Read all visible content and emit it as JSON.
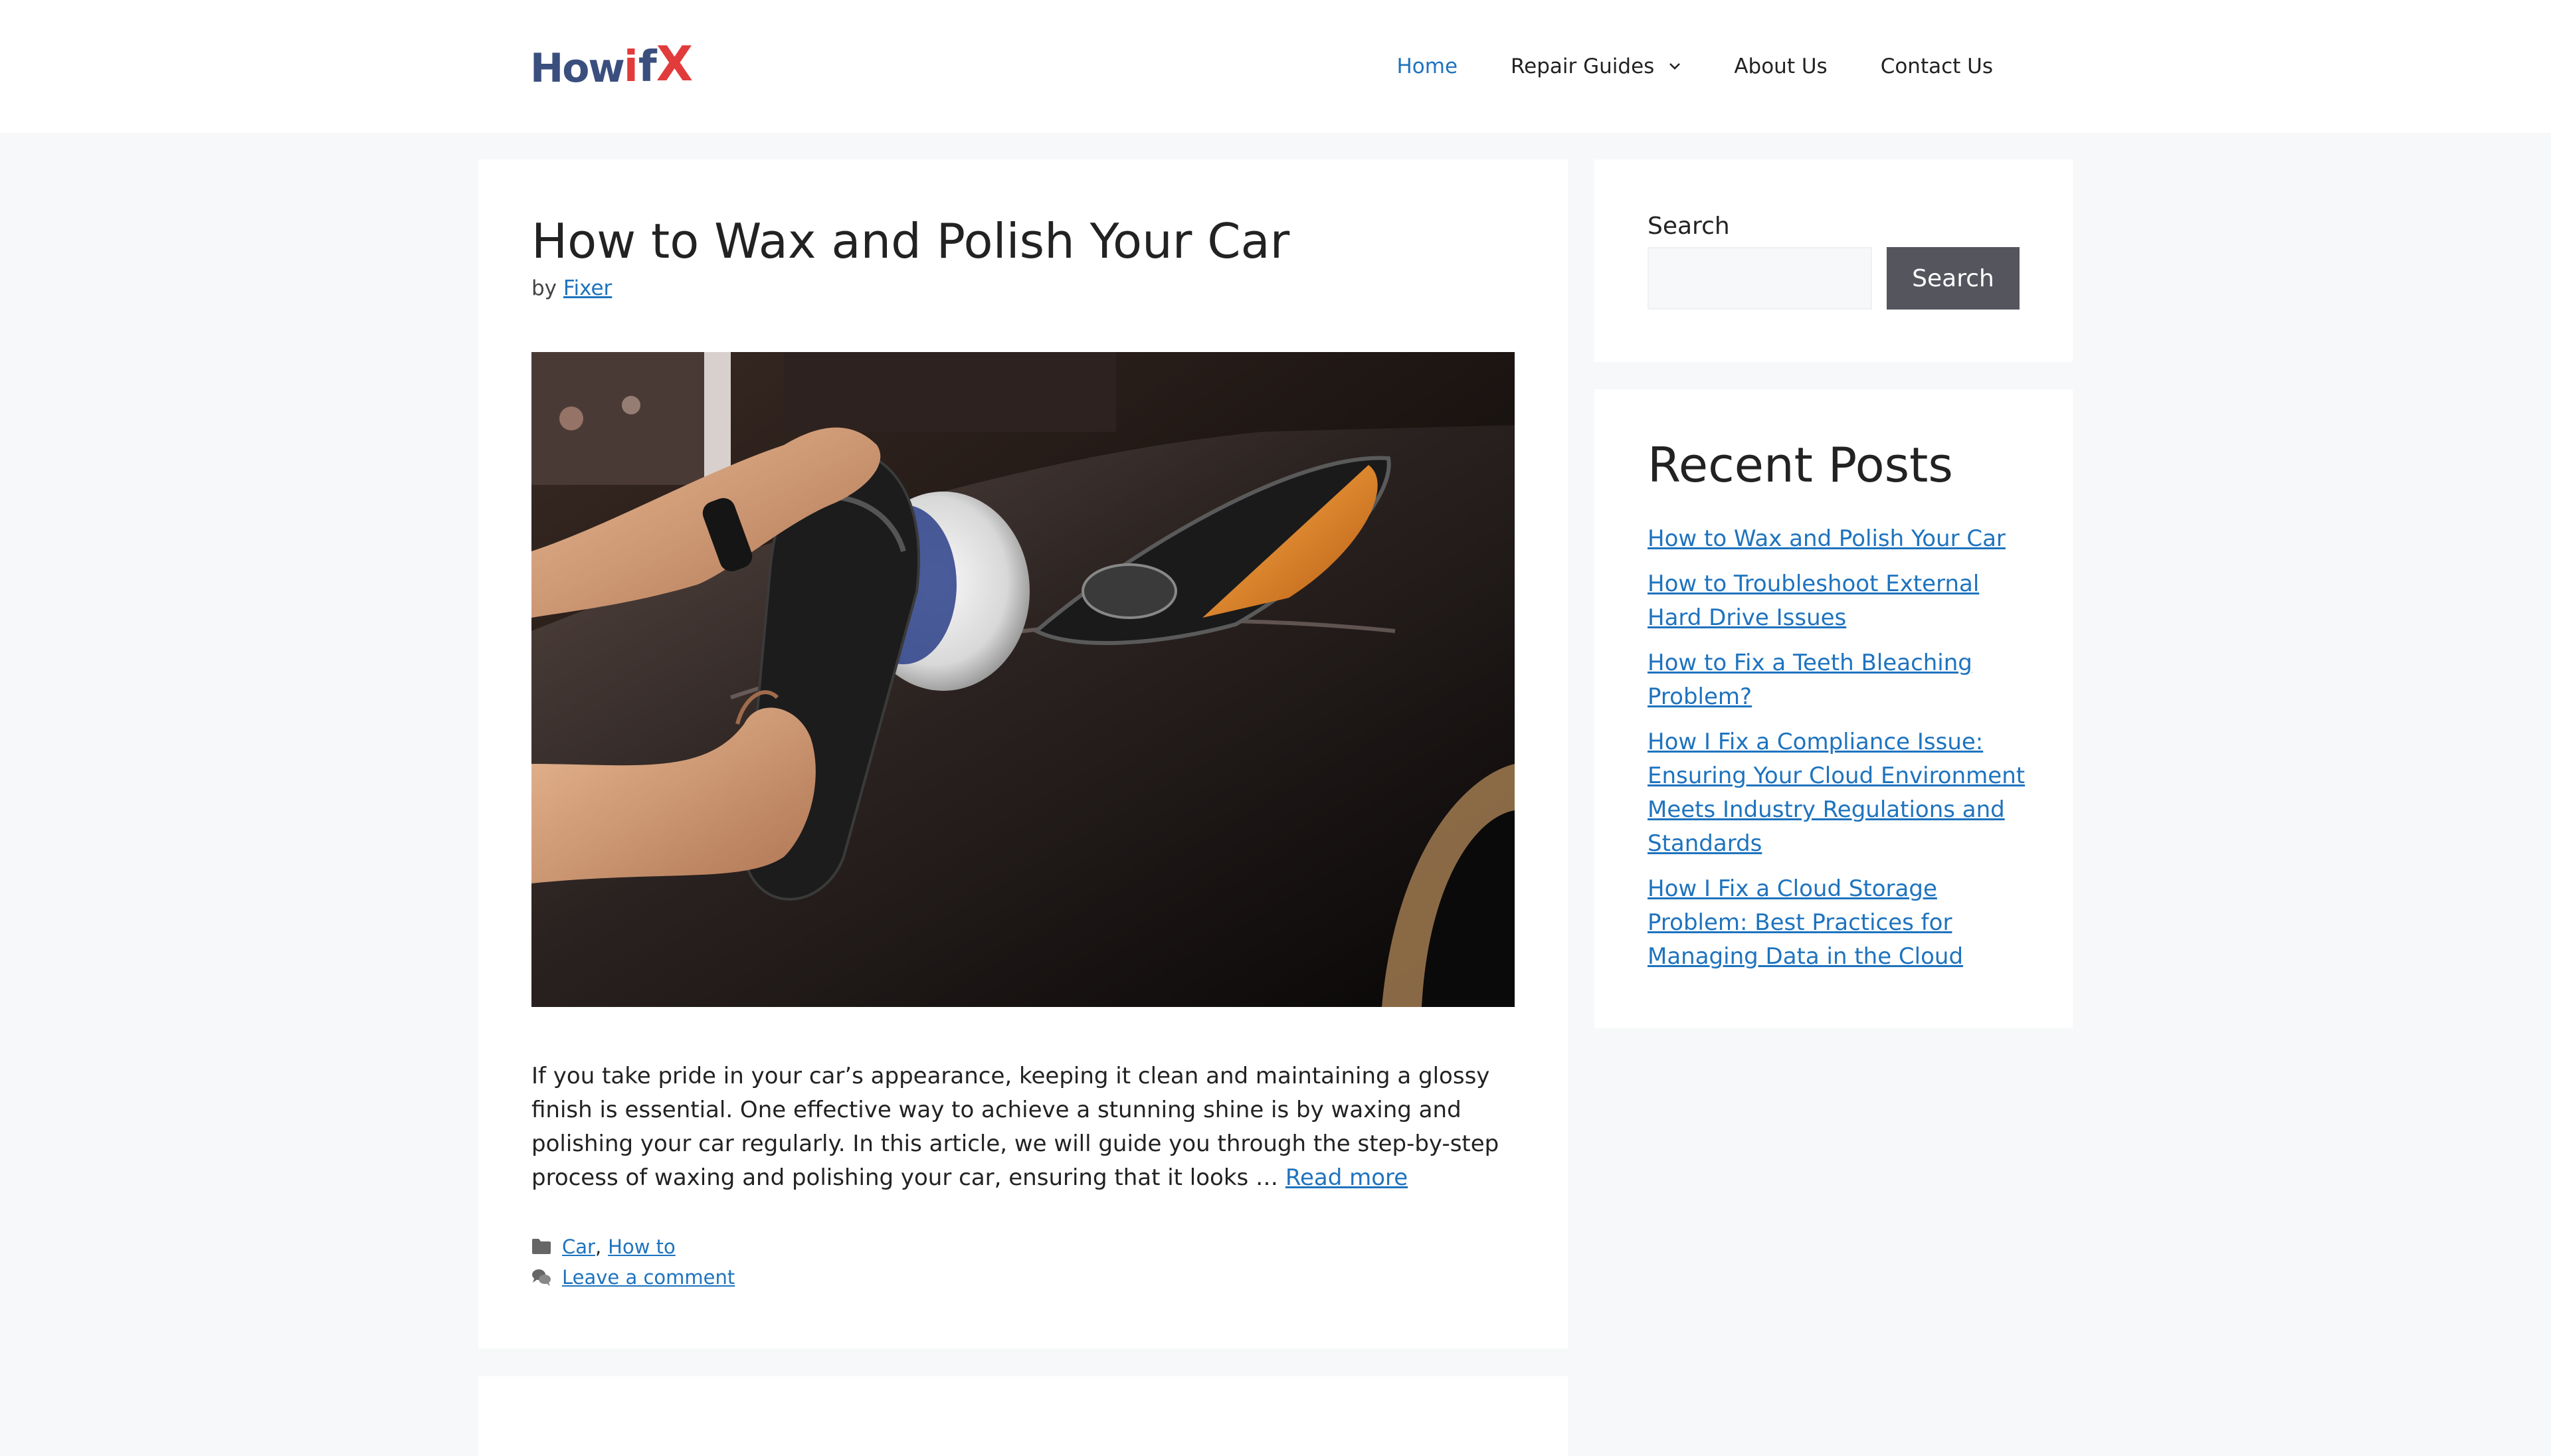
{
  "header": {
    "logo": {
      "how": "How",
      "i": "i",
      "fix": "f",
      "x": "X"
    },
    "nav": [
      {
        "label": "Home",
        "active": true
      },
      {
        "label": "Repair Guides",
        "has_dropdown": true
      },
      {
        "label": "About Us"
      },
      {
        "label": "Contact Us"
      }
    ]
  },
  "article": {
    "title": "How to Wax and Polish Your Car",
    "by": "by",
    "author": "Fixer",
    "excerpt": "If you take pride in your car’s appearance, keeping it clean and maintaining a glossy finish is essential. One effective way to achieve a stunning shine is by waxing and polishing your car regularly. In this article, we will guide you through the step-by-step process of waxing and polishing your car, ensuring that it looks … ",
    "read_more": "Read more",
    "categories": [
      "Car",
      "How to"
    ],
    "category_sep": ",",
    "comment_link": "Leave a comment"
  },
  "sidebar": {
    "search": {
      "label": "Search",
      "button": "Search",
      "value": ""
    },
    "recent": {
      "title": "Recent Posts",
      "posts": [
        "How to Wax and Polish Your Car",
        "How to Troubleshoot External Hard Drive Issues",
        "How to Fix a Teeth Bleaching Problem?",
        "How I Fix a Compliance Issue: Ensuring Your Cloud Environment Meets Industry Regulations and Standards",
        "How I Fix a Cloud Storage Problem: Best Practices for Managing Data in the Cloud"
      ]
    }
  },
  "colors": {
    "link": "#1e73be",
    "logo_blue": "#3a4f7e",
    "logo_red": "#e23b3b",
    "search_button": "#55555e",
    "page_bg": "#f7f8f9"
  },
  "icons": [
    "chevron-down-icon",
    "folder-icon",
    "comments-icon"
  ]
}
